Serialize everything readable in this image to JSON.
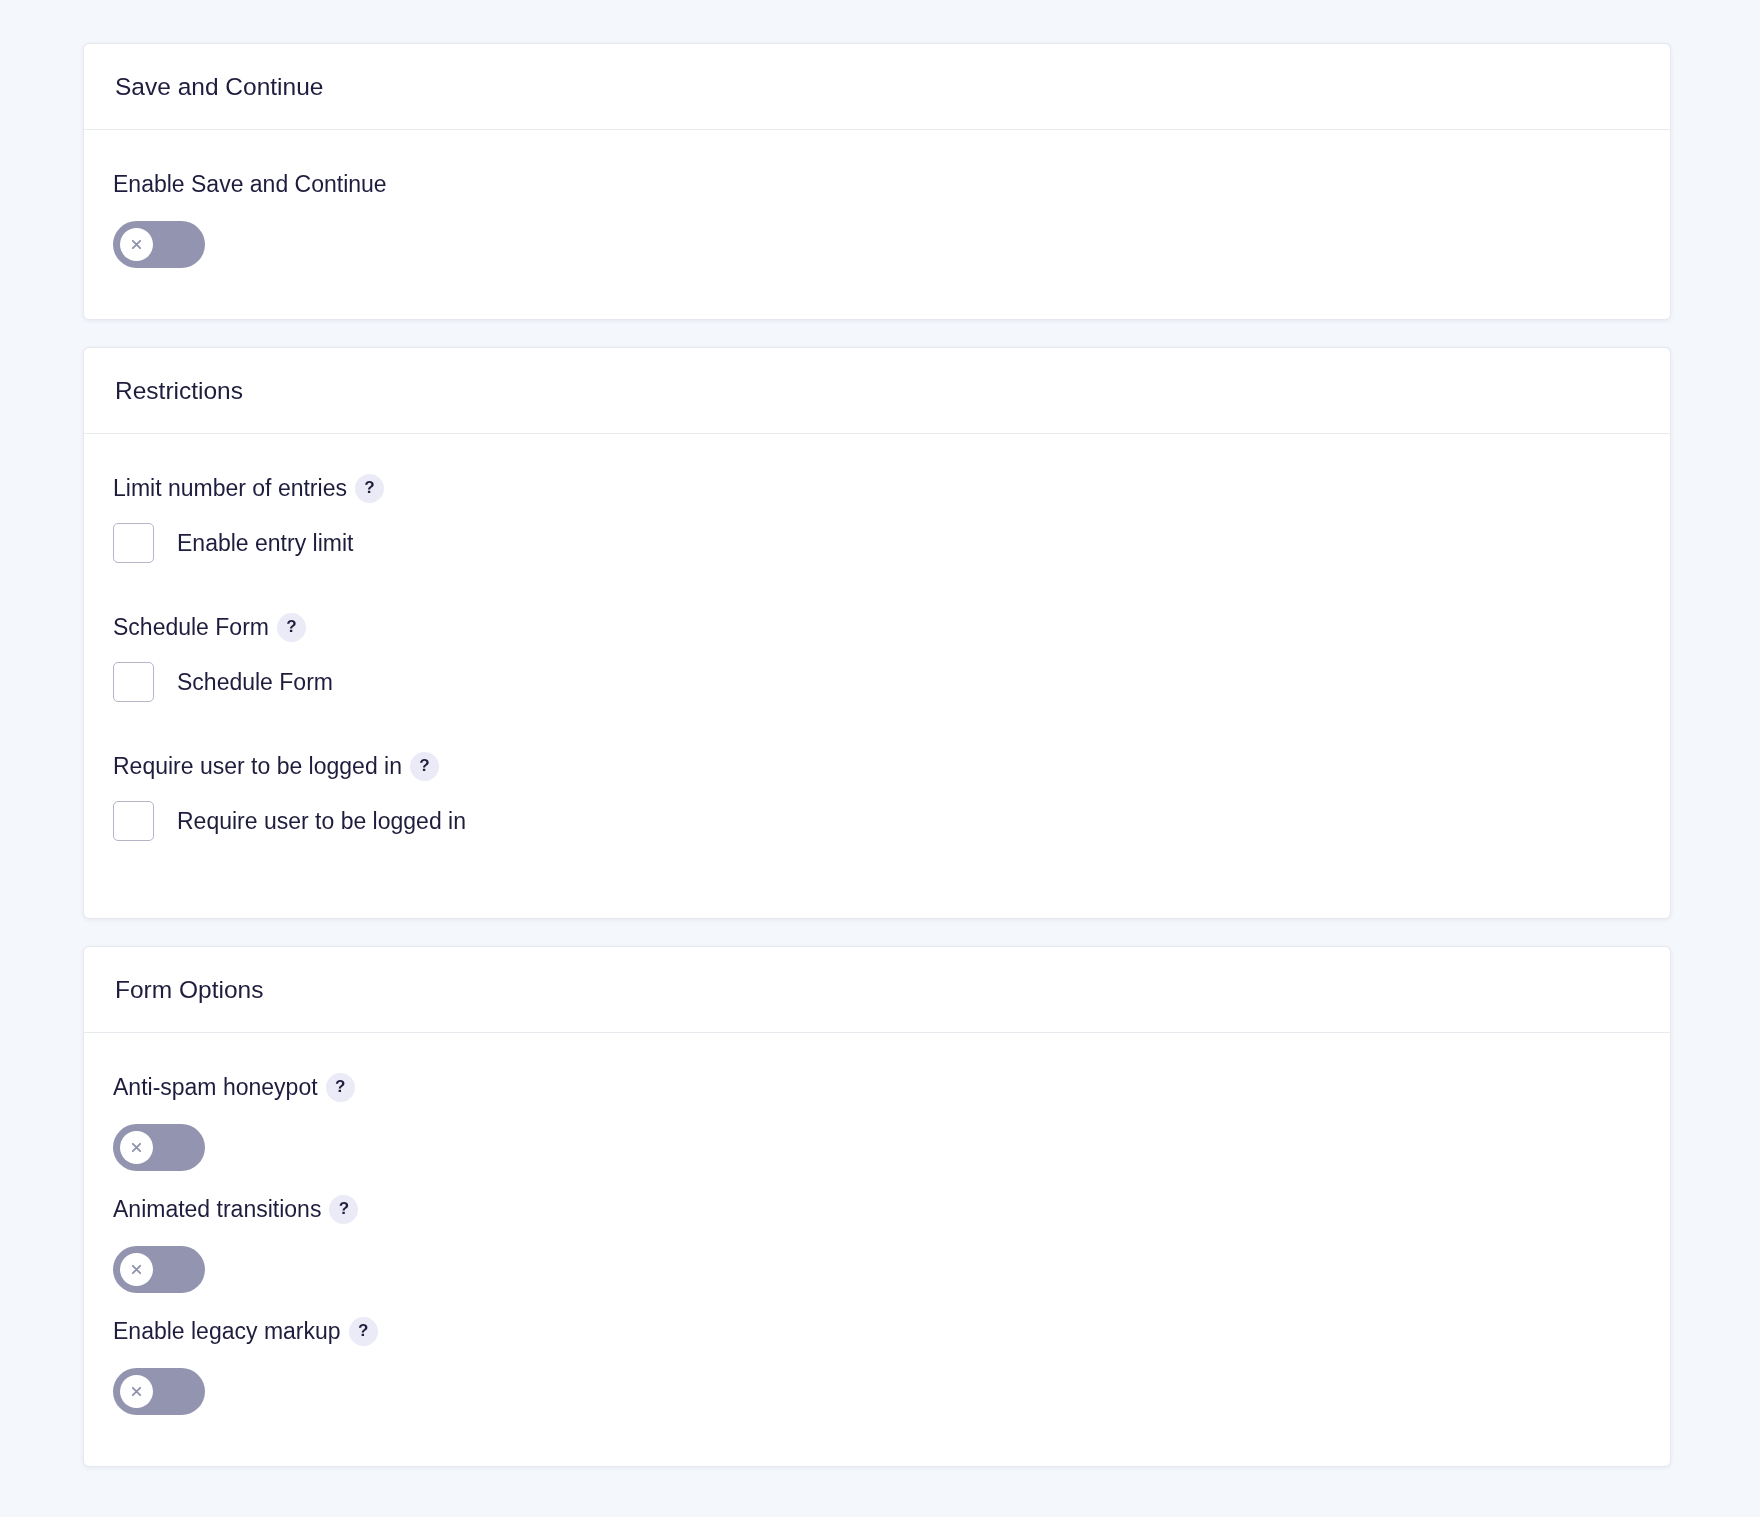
{
  "sections": [
    {
      "title": "Save and Continue",
      "fields": [
        {
          "kind": "toggle",
          "label": "Enable Save and Continue",
          "on": false
        }
      ]
    },
    {
      "title": "Restrictions",
      "fields": [
        {
          "kind": "checkbox",
          "label": "Limit number of entries",
          "help": "?",
          "option": "Enable entry limit",
          "checked": false
        },
        {
          "kind": "checkbox",
          "label": "Schedule Form",
          "help": "?",
          "option": "Schedule Form",
          "checked": false
        },
        {
          "kind": "checkbox",
          "label": "Require user to be logged in",
          "help": "?",
          "option": "Require user to be logged in",
          "checked": false
        }
      ]
    },
    {
      "title": "Form Options",
      "fields": [
        {
          "kind": "toggle",
          "label": "Anti-spam honeypot",
          "help": "?",
          "on": false
        },
        {
          "kind": "toggle",
          "label": "Animated transitions",
          "help": "?",
          "on": false
        },
        {
          "kind": "toggle",
          "label": "Enable legacy markup",
          "help": "?",
          "on": false
        }
      ]
    }
  ]
}
